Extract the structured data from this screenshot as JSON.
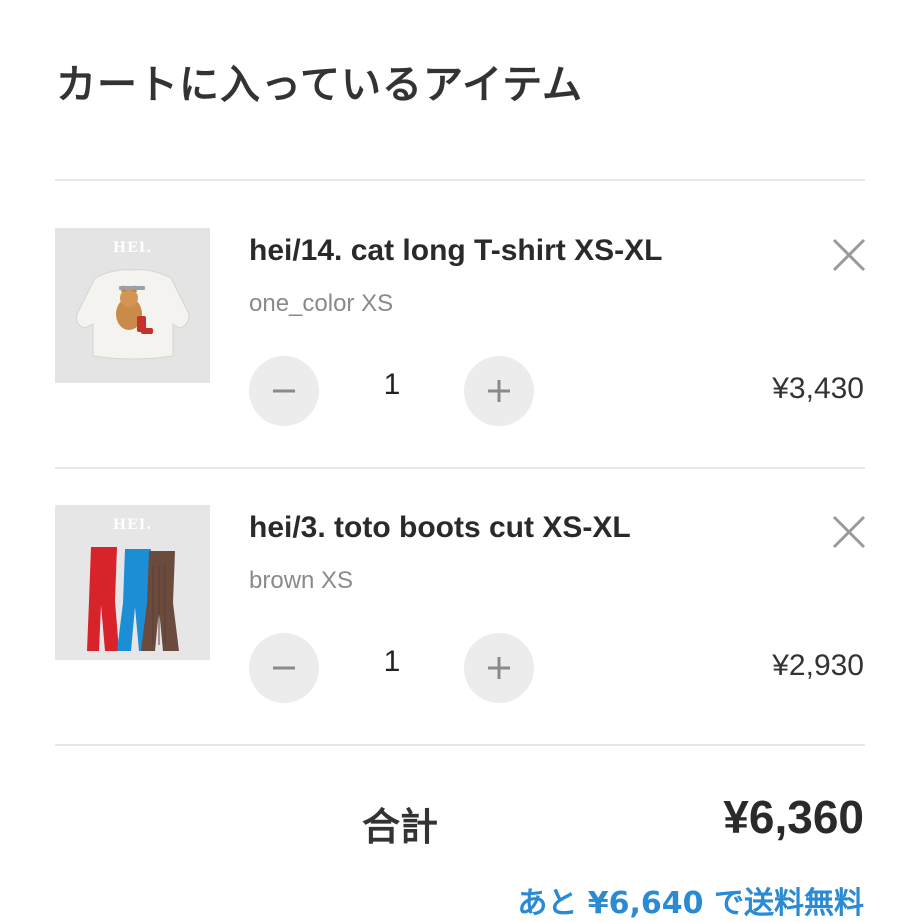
{
  "page": {
    "title": "カートに入っているアイテム"
  },
  "colors": {
    "text": "#2a2a2a",
    "muted": "#8a8a8a",
    "divider": "#e6e6e6",
    "qty_button_bg": "#ececec",
    "accent_link": "#2a8ad4"
  },
  "cart": {
    "items": [
      {
        "brand": "HEI.",
        "name": "hei/14. cat long T-shirt XS-XL",
        "variant": "one_color XS",
        "quantity": "1",
        "price": "¥3,430",
        "icons": {
          "decrease": "minus-icon",
          "increase": "plus-icon",
          "remove": "close-icon"
        }
      },
      {
        "brand": "HEI.",
        "name": "hei/3. toto boots cut XS-XL",
        "variant": "brown XS",
        "quantity": "1",
        "price": "¥2,930",
        "icons": {
          "decrease": "minus-icon",
          "increase": "plus-icon",
          "remove": "close-icon"
        }
      }
    ],
    "total_label": "合計",
    "total_value": "¥6,360",
    "shipping_note": "あと ¥6,640 で送料無料"
  }
}
